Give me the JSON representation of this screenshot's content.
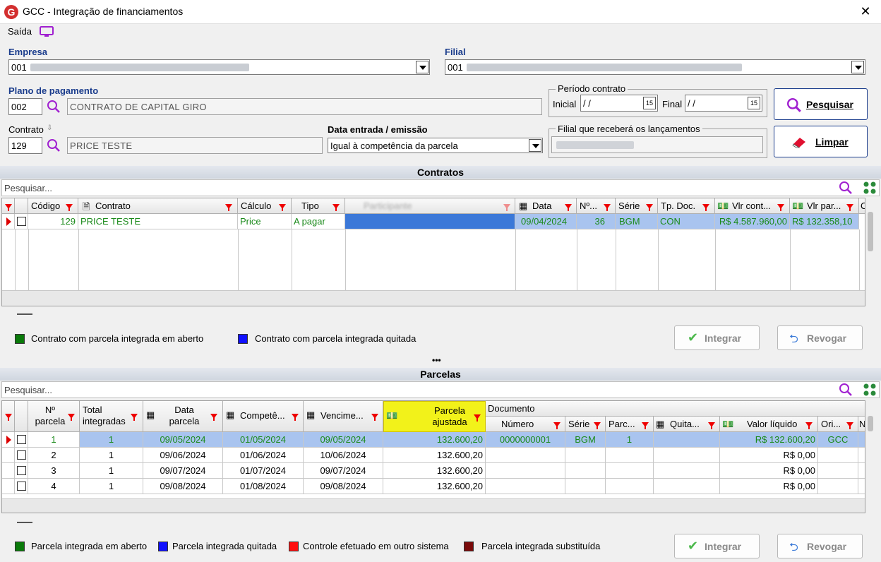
{
  "window": {
    "title": "GCC - Integração de financiamentos",
    "logo": "G"
  },
  "menu": {
    "saida": "Saída"
  },
  "form": {
    "empresa_label": "Empresa",
    "empresa_value": "001",
    "filial_label": "Filial",
    "filial_value": "001",
    "plano_label": "Plano de pagamento",
    "plano_code": "002",
    "plano_desc": "CONTRATO DE CAPITAL GIRO",
    "periodo_label": "Período contrato",
    "inicial_label": "Inicial",
    "inicial_value": " / /",
    "final_label": "Final",
    "final_value": " / /",
    "cal_glyph": "15",
    "contrato_label": "Contrato",
    "contrato_code": "129",
    "contrato_desc": "PRICE TESTE",
    "data_label": "Data entrada / emissão",
    "data_value": "Igual à competência da parcela",
    "filial_receb_label": "Filial que receberá os lançamentos"
  },
  "buttons": {
    "pesquisar": "Pesquisar",
    "limpar": "Limpar",
    "integrar": "Integrar",
    "revogar": "Revogar"
  },
  "contratos": {
    "title": "Contratos",
    "search_placeholder": "Pesquisar...",
    "columns": [
      "Código",
      "Contrato",
      "Cálculo",
      "Tipo",
      "Participante",
      "Data",
      "Nº...",
      "Série",
      "Tp. Doc.",
      "Vlr cont...",
      "Vlr par...",
      "C"
    ],
    "row": {
      "codigo": "129",
      "contrato": "PRICE TESTE",
      "calculo": "Price",
      "tipo": "A pagar",
      "data": "09/04/2024",
      "num": "36",
      "serie": "BGM",
      "tpdoc": "CON",
      "vlr_cont": "R$ 4.587.960,00",
      "vlr_par": "R$ 132.358,10"
    },
    "legend": [
      {
        "label": "Contrato com parcela integrada em aberto",
        "color": "#0a7a0a"
      },
      {
        "label": "Contrato com parcela integrada quitada",
        "color": "#1010ff"
      }
    ]
  },
  "parcelas": {
    "title": "Parcelas",
    "search_placeholder": "Pesquisar...",
    "documento_group": "Documento",
    "columns": {
      "num": "Nº parcela",
      "total": "Total integradas",
      "data": "Data parcela",
      "compet": "Competê...",
      "venc": "Vencime...",
      "ajust": "Parcela ajustada",
      "numero": "Número",
      "serie": "Série",
      "parc": "Parc...",
      "quita": "Quita...",
      "valor": "Valor líquido",
      "ori": "Ori...",
      "n": "N"
    },
    "rows": [
      {
        "num": "1",
        "total": "1",
        "data": "09/05/2024",
        "compet": "01/05/2024",
        "venc": "09/05/2024",
        "ajust": "132.600,20",
        "numero": "0000000001",
        "serie": "BGM",
        "parc": "1",
        "valor": "R$ 132.600,20",
        "ori": "GCC"
      },
      {
        "num": "2",
        "total": "1",
        "data": "09/06/2024",
        "compet": "01/06/2024",
        "venc": "10/06/2024",
        "ajust": "132.600,20",
        "numero": "",
        "serie": "",
        "parc": "",
        "valor": "R$ 0,00",
        "ori": ""
      },
      {
        "num": "3",
        "total": "1",
        "data": "09/07/2024",
        "compet": "01/07/2024",
        "venc": "09/07/2024",
        "ajust": "132.600,20",
        "numero": "",
        "serie": "",
        "parc": "",
        "valor": "R$ 0,00",
        "ori": ""
      },
      {
        "num": "4",
        "total": "1",
        "data": "09/08/2024",
        "compet": "01/08/2024",
        "venc": "09/08/2024",
        "ajust": "132.600,20",
        "numero": "",
        "serie": "",
        "parc": "",
        "valor": "R$ 0,00",
        "ori": ""
      }
    ],
    "legend": [
      {
        "label": "Parcela integrada em aberto",
        "color": "#0a7a0a"
      },
      {
        "label": "Parcela integrada quitada",
        "color": "#1010ff"
      },
      {
        "label": "Controle efetuado em outro sistema",
        "color": "#ff1010"
      },
      {
        "label": "Parcela integrada substituída",
        "color": "#7a0a0a"
      }
    ]
  },
  "splitter": "•••"
}
